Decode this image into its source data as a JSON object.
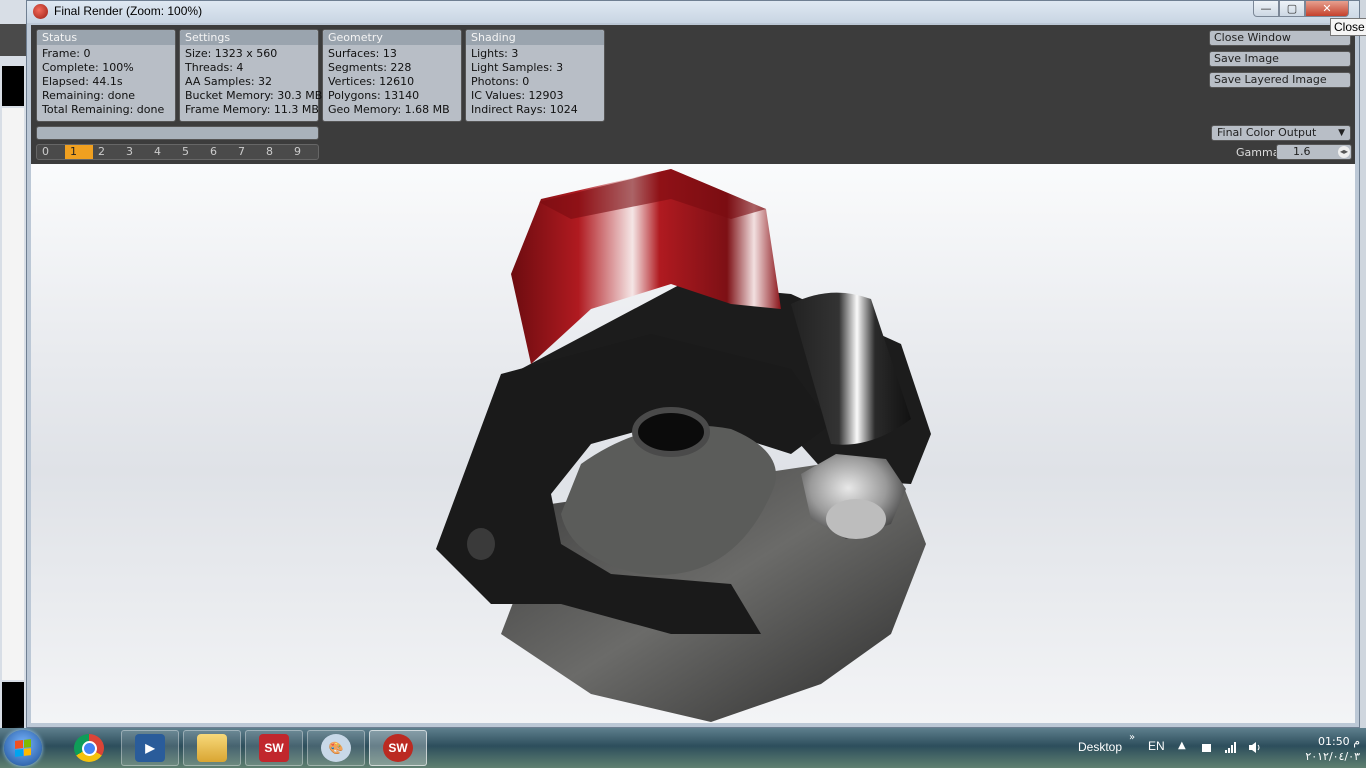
{
  "window": {
    "title": "Final Render (Zoom: 100%)",
    "close_tooltip": "Close"
  },
  "status": {
    "header": "Status",
    "rows": [
      "Frame: 0",
      "Complete: 100%",
      "Elapsed: 44.1s",
      "Remaining: done",
      "Total Remaining: done"
    ]
  },
  "settings": {
    "header": "Settings",
    "rows": [
      "Size: 1323 x 560",
      "Threads: 4",
      "AA Samples: 32",
      "Bucket Memory: 30.3 MB",
      "Frame Memory: 11.3 MB"
    ]
  },
  "geometry": {
    "header": "Geometry",
    "rows": [
      "Surfaces: 13",
      "Segments: 228",
      "Vertices: 12610",
      "Polygons: 13140",
      "Geo Memory: 1.68 MB"
    ]
  },
  "shading": {
    "header": "Shading",
    "rows": [
      "Lights: 3",
      "Light Samples: 3",
      "Photons: 0",
      "IC Values: 12903",
      "Indirect Rays: 1024"
    ]
  },
  "slots": {
    "items": [
      "0",
      "1",
      "2",
      "3",
      "4",
      "5",
      "6",
      "7",
      "8",
      "9"
    ],
    "active_index": 1
  },
  "actions": {
    "close_window": "Close Window",
    "save_image": "Save Image",
    "save_layered": "Save Layered Image"
  },
  "output": {
    "selected": "Final Color Output",
    "gamma_label": "Gamma",
    "gamma_value": "1.6"
  },
  "taskbar": {
    "desktop_label": "Desktop",
    "language": "EN",
    "time": "01:50 م",
    "date": "٢٠١٢/٠٤/٠٣",
    "icons": [
      "start-icon",
      "chrome-icon",
      "media-player-icon",
      "folder-icon",
      "solidworks-icon",
      "paint-icon",
      "photoview-icon"
    ]
  },
  "colors": {
    "panel_bg": "#3c3c3c",
    "group_bg": "#b8bec6",
    "active_slot": "#f0a020",
    "knob_red": "#a8141a",
    "clamp_black": "#1e1e1e"
  }
}
